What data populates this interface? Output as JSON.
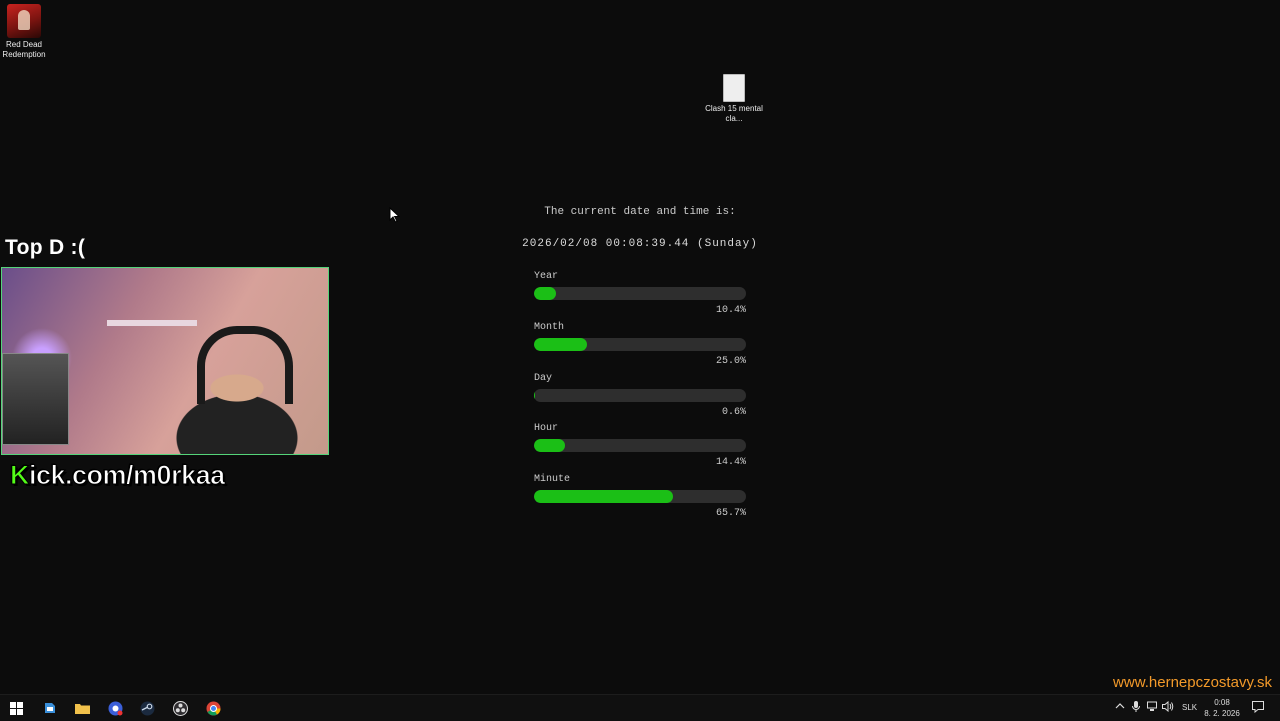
{
  "desktop": {
    "icons": [
      {
        "label": "Red Dead Redemption",
        "icon": "red-dead-redemption-icon"
      },
      {
        "label": "Clash 15 mental cla...",
        "icon": "file-icon"
      }
    ]
  },
  "overlay": {
    "title": "Top D :(",
    "kick_k": "K",
    "kick_rest": "ick.com/m0rkaa",
    "watermark": "www.hernepczostavy.sk"
  },
  "clock": {
    "heading": "The current date and time is:",
    "value": "2026/02/08 00:08:39.44 (Sunday)",
    "progress": [
      {
        "label": "Year",
        "percent_text": "10.4%",
        "value": 10.4
      },
      {
        "label": "Month",
        "percent_text": "25.0%",
        "value": 25.0
      },
      {
        "label": "Day",
        "percent_text": "0.6%",
        "value": 0.6
      },
      {
        "label": "Hour",
        "percent_text": "14.4%",
        "value": 14.4
      },
      {
        "label": "Minute",
        "percent_text": "65.7%",
        "value": 65.7
      }
    ],
    "bar_color": "#1bbf16"
  },
  "taskbar": {
    "apps": [
      "windows-start-icon",
      "explorer-icon",
      "folder-icon",
      "browser-icon",
      "steam-icon",
      "obs-icon",
      "chrome-icon"
    ],
    "language": "SLK",
    "time": "0:08",
    "date": "8. 2. 2026"
  }
}
